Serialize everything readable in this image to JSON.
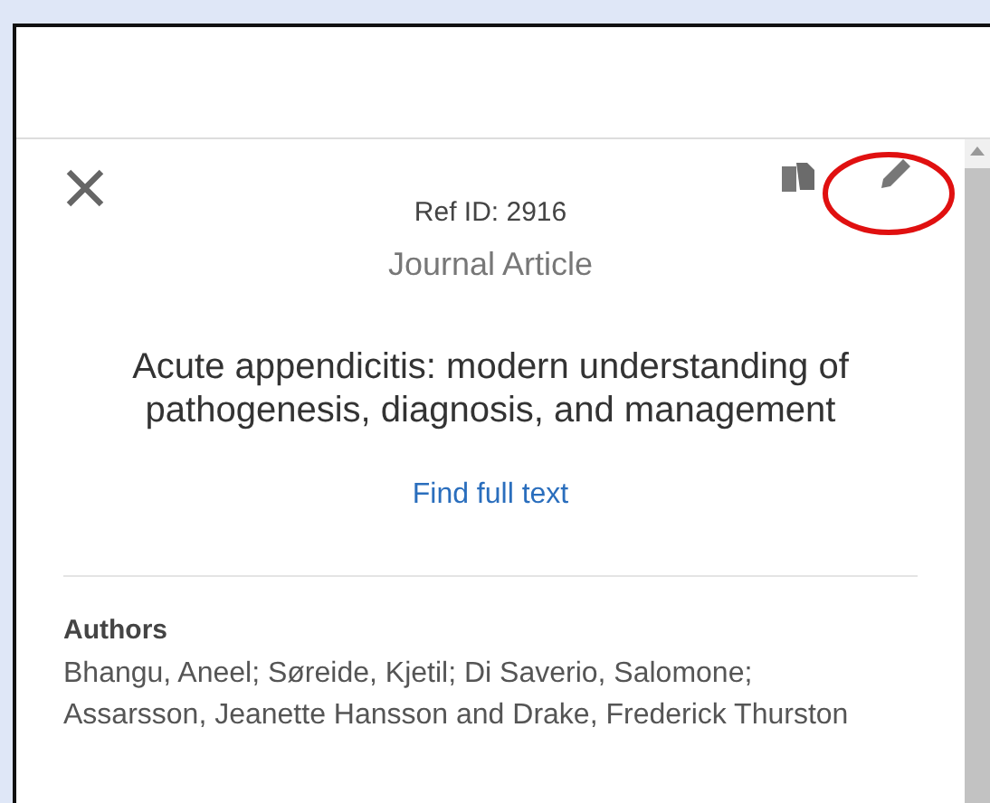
{
  "record": {
    "ref_id": "Ref ID: 2916",
    "type": "Journal Article",
    "title": "Acute appendicitis: modern understanding of pathogenesis, diagnosis, and management",
    "link": "Find full text"
  },
  "fields": [
    {
      "label": "Authors",
      "value": "Bhangu, Aneel; Søreide, Kjetil; Di Saverio, Salomone; Assarsson, Jeanette Hansson and Drake, Frederick Thurston"
    }
  ]
}
